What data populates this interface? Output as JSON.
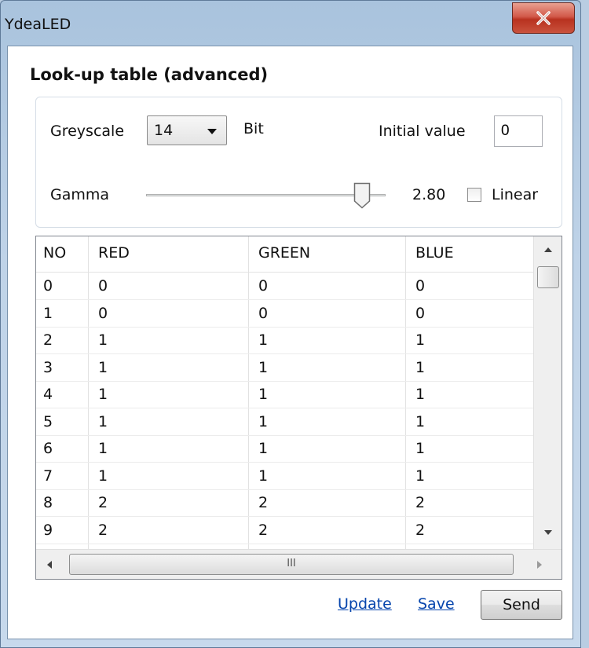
{
  "window": {
    "title": "YdeaLED"
  },
  "heading": "Look-up table (advanced)",
  "settings": {
    "greyscale_label": "Greyscale",
    "greyscale_value": "14",
    "bit_label": "Bit",
    "initial_value_label": "Initial value",
    "initial_value": "0",
    "gamma_label": "Gamma",
    "gamma_value": "2.80",
    "gamma_level_fraction": 0.9,
    "linear_label": "Linear",
    "linear_checked": false
  },
  "table": {
    "columns": [
      "NO",
      "RED",
      "GREEN",
      "BLUE"
    ],
    "rows": [
      [
        "0",
        "0",
        "0",
        "0"
      ],
      [
        "1",
        "0",
        "0",
        "0"
      ],
      [
        "2",
        "1",
        "1",
        "1"
      ],
      [
        "3",
        "1",
        "1",
        "1"
      ],
      [
        "4",
        "1",
        "1",
        "1"
      ],
      [
        "5",
        "1",
        "1",
        "1"
      ],
      [
        "6",
        "1",
        "1",
        "1"
      ],
      [
        "7",
        "1",
        "1",
        "1"
      ],
      [
        "8",
        "2",
        "2",
        "2"
      ],
      [
        "9",
        "2",
        "2",
        "2"
      ]
    ],
    "hscroll_grip": "III"
  },
  "actions": {
    "update_label": "Update",
    "save_label": "Save",
    "send_label": "Send"
  },
  "icons": {
    "close": "close-icon",
    "combo_arrow": "chevron-down-icon"
  }
}
